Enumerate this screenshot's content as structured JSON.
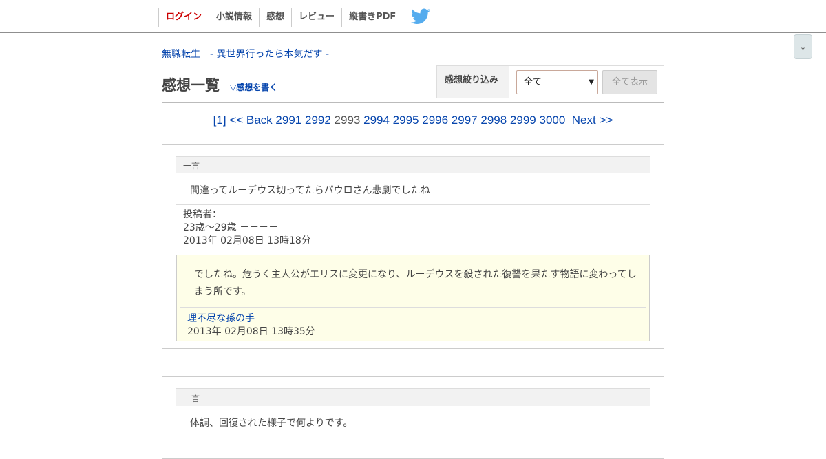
{
  "nav": {
    "items": [
      "ログイン",
      "小説情報",
      "感想",
      "レビュー",
      "縦書きPDF"
    ]
  },
  "icons": {
    "twitter": "twitter-bird-icon",
    "scroll": "scroll-down-icon"
  },
  "colors": {
    "link": "#0645ad",
    "login": "#cc0000",
    "twitter": "#55acee",
    "reply_bg": "#fefee8"
  },
  "scroll_button": "↓",
  "novel_title": {
    "part1": "無職転生",
    "part2": "- 異世界行ったら本気だす -"
  },
  "heading": "感想一覧",
  "write_link": "▽感想を書く",
  "filter": {
    "label": "感想絞り込み",
    "selected": "全て",
    "show_all": "全て表示"
  },
  "pager": {
    "first": "[1]",
    "back": "<< Back",
    "pages_before": [
      "2991",
      "2992"
    ],
    "current": "2993",
    "pages_after": [
      "2994",
      "2995",
      "2996",
      "2997",
      "2998",
      "2999",
      "3000"
    ],
    "next": "Next >>"
  },
  "comments": [
    {
      "section_label": "一言",
      "text": "間違ってルーデウス切ってたらパウロさん悲劇でしたね",
      "poster_label": "投稿者：",
      "poster_age": "23歳～29歳 －－－－",
      "date": "2013年 02月08日 13時18分",
      "reply": {
        "text": "でしたね。危うく主人公がエリスに変更になり、ルーデウスを殺された復讐を果たす物語に変わってしまう所です。",
        "author": "理不尽な孫の手",
        "date": "2013年 02月08日 13時35分"
      }
    },
    {
      "section_label": "一言",
      "text": "体調、回復された様子で何よりです。"
    }
  ]
}
